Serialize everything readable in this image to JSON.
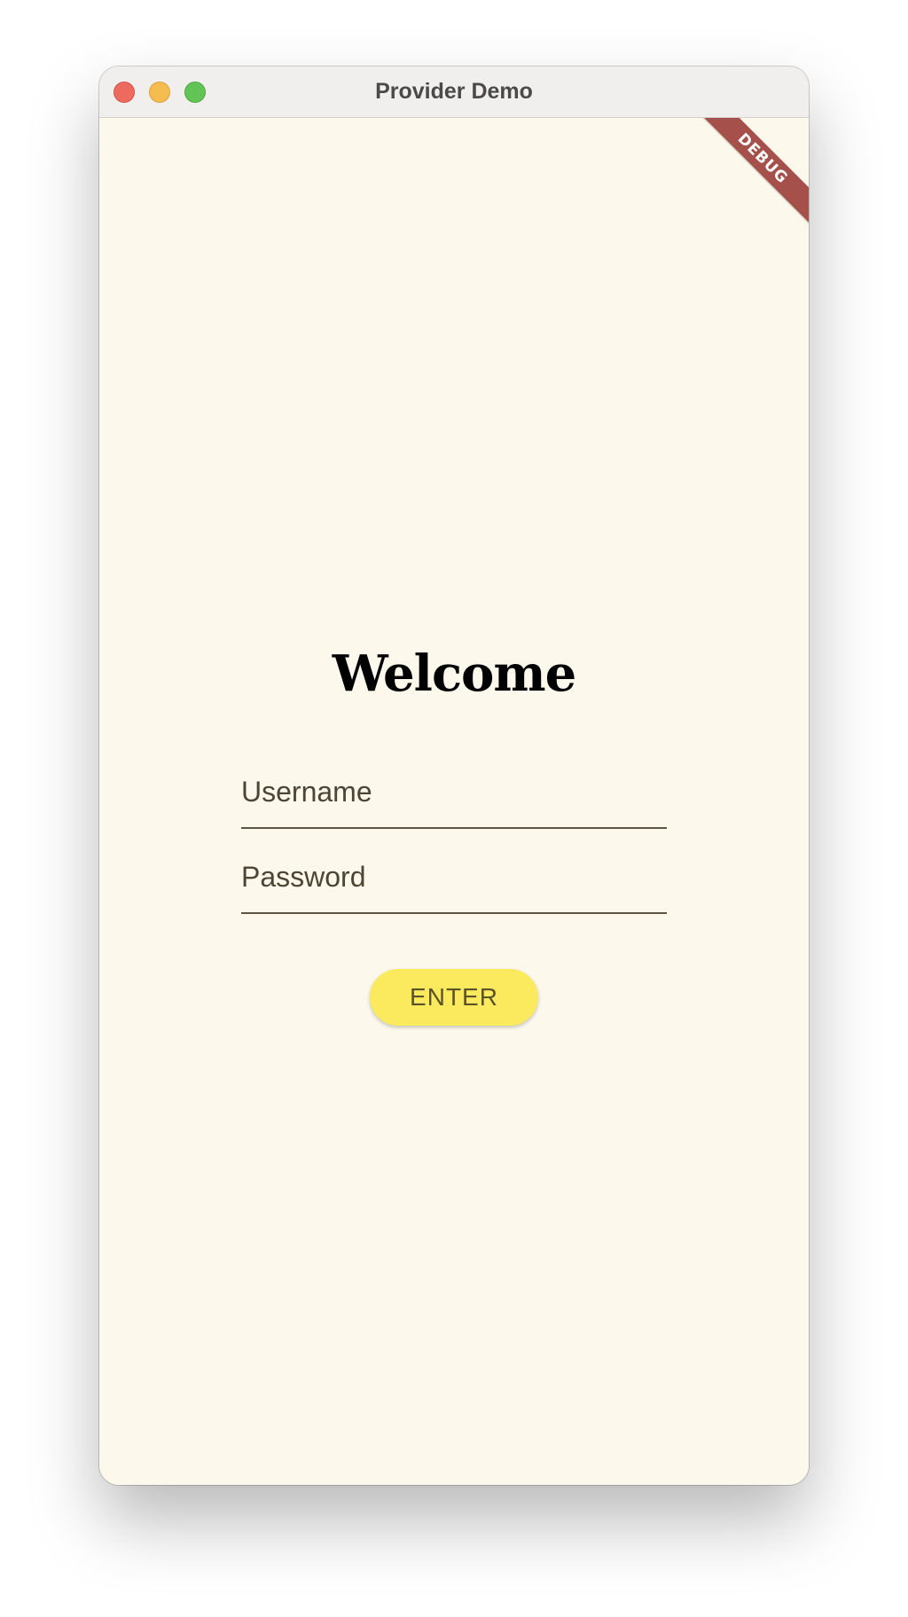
{
  "window": {
    "title": "Provider Demo",
    "controls": [
      "close",
      "minimize",
      "zoom"
    ]
  },
  "debug_banner": {
    "label": "DEBUG",
    "color": "#a6504c"
  },
  "login": {
    "heading": "Welcome",
    "username": {
      "placeholder": "Username",
      "value": ""
    },
    "password": {
      "placeholder": "Password",
      "value": ""
    },
    "enter_label": "ENTER"
  },
  "colors": {
    "background": "#fcf8ec",
    "button": "#fbe95e",
    "close": "#ee6a5f",
    "minimize": "#f5bd4f",
    "zoom": "#61c454"
  }
}
